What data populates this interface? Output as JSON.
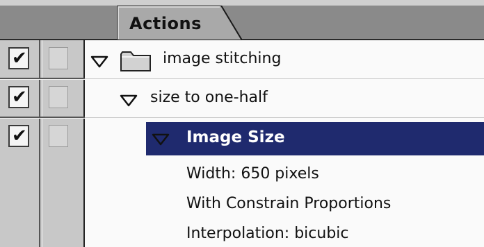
{
  "panel": {
    "tab_label": "Actions"
  },
  "actions": [
    {
      "label": "image stitching",
      "type": "set",
      "checked": true,
      "expanded": true
    },
    {
      "label": "size to one-half",
      "type": "action",
      "checked": true,
      "expanded": true
    },
    {
      "label": "Image Size",
      "type": "command",
      "checked": true,
      "expanded": true,
      "selected": true
    }
  ],
  "details": [
    "Width: 650 pixels",
    "With Constrain Proportions",
    "Interpolation: bicubic"
  ],
  "icons": {
    "check": "check-icon",
    "triangle": "disclosure-triangle-icon",
    "folder": "folder-icon"
  },
  "colors": {
    "selection": "#1f2a6e",
    "tab_bg": "#a8a8a8",
    "panel_bg": "#fafafa"
  }
}
